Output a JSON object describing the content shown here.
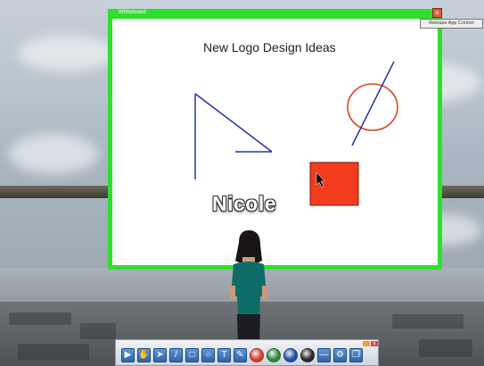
{
  "whiteboard": {
    "title": "Whiteboard",
    "heading": "New Logo Design Ideas",
    "close_glyph": "×",
    "release_label": "Release App Control",
    "accent": "#2ee02e"
  },
  "avatar": {
    "name": "Nicole"
  },
  "toolbar": {
    "tools": [
      {
        "name": "play-icon",
        "glyph": "▶"
      },
      {
        "name": "hand-icon",
        "glyph": "✋"
      },
      {
        "name": "pointer-icon",
        "glyph": "➤"
      },
      {
        "name": "line-icon",
        "glyph": "/"
      },
      {
        "name": "rectangle-icon",
        "glyph": "□"
      },
      {
        "name": "circle-icon",
        "glyph": "○"
      },
      {
        "name": "text-icon",
        "glyph": "T"
      },
      {
        "name": "eraser-icon",
        "glyph": "✎"
      }
    ],
    "colors": [
      "#e23b2e",
      "#2e8b3a",
      "#1f4fa8",
      "#2a2a2a"
    ],
    "extra": [
      {
        "name": "pen-size-icon",
        "glyph": "—"
      },
      {
        "name": "settings-icon",
        "glyph": "⚙"
      },
      {
        "name": "pages-icon",
        "glyph": "❐"
      }
    ]
  }
}
